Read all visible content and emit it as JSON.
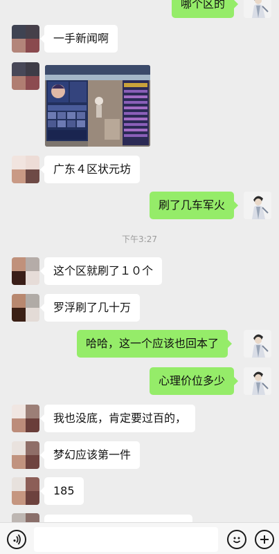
{
  "timestamp": "下午3:27",
  "messages": [
    {
      "side": "right",
      "text": "哪个区的"
    },
    {
      "side": "left",
      "text": "一手新闻啊"
    },
    {
      "side": "left",
      "type": "image",
      "description": "game-screenshot"
    },
    {
      "side": "left",
      "text": "广东４区状元坊"
    },
    {
      "side": "right",
      "text": "刷了几车军火"
    },
    {
      "side": "left",
      "text": "这个区就刷了１０个"
    },
    {
      "side": "left",
      "text": "罗浮刷了几十万"
    },
    {
      "side": "right",
      "text": "哈哈，这一个应该也回本了"
    },
    {
      "side": "right",
      "text": "心理价位多少"
    },
    {
      "side": "left",
      "text": "我也没底，肯定要过百的，"
    },
    {
      "side": "left",
      "text": "梦幻应该第一件"
    },
    {
      "side": "left",
      "text": "185"
    }
  ],
  "colors": {
    "background": "#ededed",
    "bubble_self": "#95ec69",
    "bubble_other": "#ffffff",
    "text": "#111111"
  },
  "input": {
    "value": "",
    "placeholder": ""
  },
  "icons": {
    "voice": "voice-icon",
    "emoji": "emoji-icon",
    "more": "plus-icon"
  }
}
